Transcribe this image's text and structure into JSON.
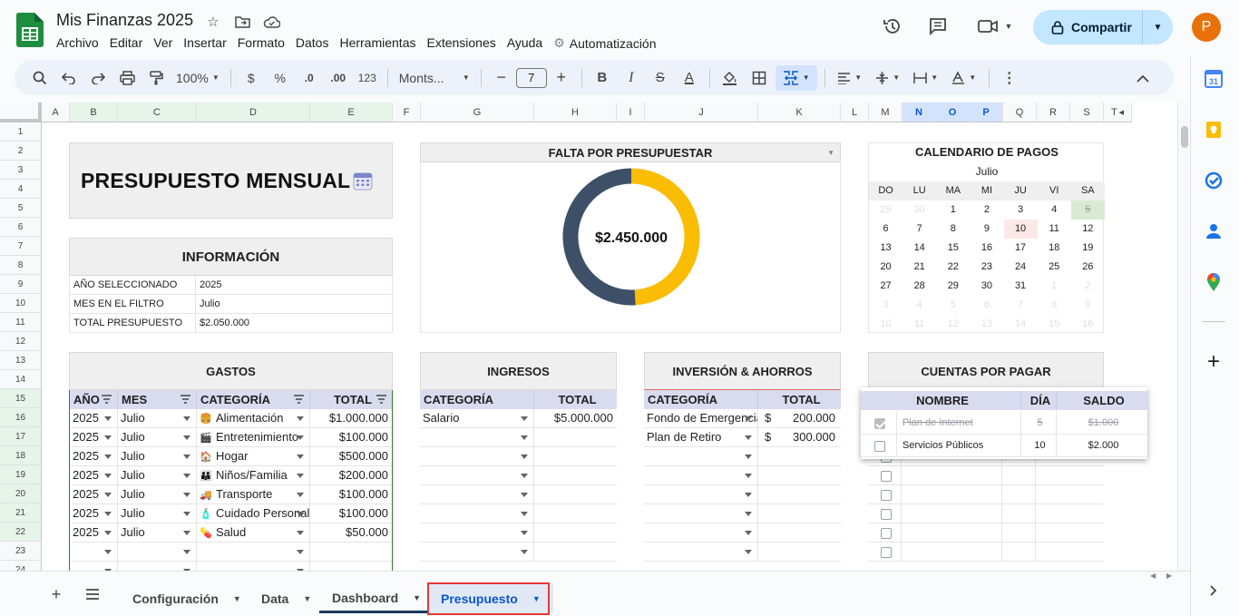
{
  "app": {
    "doc_title": "Mis Finanzas 2025",
    "menu": [
      "Archivo",
      "Editar",
      "Ver",
      "Insertar",
      "Formato",
      "Datos",
      "Herramientas",
      "Extensiones",
      "Ayuda"
    ],
    "automation_label": "Automatización",
    "share_label": "Compartir",
    "avatar_initial": "P"
  },
  "toolbar": {
    "zoom": "100%",
    "currency": "$",
    "percent": "%",
    "dec_decrease": ".0",
    "dec_increase": ".00",
    "number_format": "123",
    "font_name": "Monts...",
    "font_size": "7",
    "bold": "B",
    "italic": "I",
    "strike": "S",
    "text_color": "A"
  },
  "grid": {
    "columns": [
      "A",
      "B",
      "C",
      "D",
      "E",
      "F",
      "G",
      "H",
      "I",
      "J",
      "K",
      "L",
      "M",
      "N",
      "O",
      "P",
      "Q",
      "R",
      "S",
      "T"
    ],
    "rows": [
      "1",
      "2",
      "3",
      "4",
      "5",
      "6",
      "7",
      "8",
      "9",
      "10",
      "11",
      "12",
      "13",
      "14",
      "15",
      "16",
      "17",
      "18",
      "19",
      "20",
      "21",
      "22",
      "23",
      "24"
    ]
  },
  "presupuesto": {
    "title": "PRESUPUESTO MENSUAL",
    "info_header": "INFORMACIÓN",
    "info": [
      {
        "k": "AÑO SELECCIONADO",
        "v": "2025"
      },
      {
        "k": "MES EN EL FILTRO",
        "v": "Julio"
      },
      {
        "k": "TOTAL PRESUPUESTO",
        "v": "$2.050.000"
      }
    ]
  },
  "falta": {
    "header": "FALTA POR PRESUPUESTAR",
    "center_label": "$2.450.000",
    "colors": {
      "filled": "#fbbc04",
      "remaining": "#3d5068"
    }
  },
  "chart_data": {
    "type": "pie",
    "title": "FALTA POR PRESUPUESTAR",
    "center_label": "$2.450.000",
    "slices": [
      {
        "value": 49,
        "color": "#fbbc04"
      },
      {
        "value": 51,
        "color": "#3d5068"
      }
    ]
  },
  "calendario": {
    "header": "CALENDARIO DE PAGOS",
    "month": "Julio",
    "weekdays": [
      "DO",
      "LU",
      "MA",
      "MI",
      "JU",
      "VI",
      "SA"
    ],
    "weeks": [
      [
        {
          "d": "29",
          "s": "dim"
        },
        {
          "d": "30",
          "s": "dim"
        },
        {
          "d": "1"
        },
        {
          "d": "2"
        },
        {
          "d": "3"
        },
        {
          "d": "4"
        },
        {
          "d": "5",
          "s": "done"
        }
      ],
      [
        {
          "d": "6"
        },
        {
          "d": "7"
        },
        {
          "d": "8"
        },
        {
          "d": "9"
        },
        {
          "d": "10",
          "s": "today"
        },
        {
          "d": "11"
        },
        {
          "d": "12"
        }
      ],
      [
        {
          "d": "13"
        },
        {
          "d": "14"
        },
        {
          "d": "15"
        },
        {
          "d": "16"
        },
        {
          "d": "17"
        },
        {
          "d": "18"
        },
        {
          "d": "19"
        }
      ],
      [
        {
          "d": "20"
        },
        {
          "d": "21"
        },
        {
          "d": "22"
        },
        {
          "d": "23"
        },
        {
          "d": "24"
        },
        {
          "d": "25"
        },
        {
          "d": "26"
        }
      ],
      [
        {
          "d": "27"
        },
        {
          "d": "28"
        },
        {
          "d": "29"
        },
        {
          "d": "30"
        },
        {
          "d": "31"
        },
        {
          "d": "1",
          "s": "dim"
        },
        {
          "d": "2",
          "s": "dim"
        }
      ],
      [
        {
          "d": "3",
          "s": "dim"
        },
        {
          "d": "4",
          "s": "dim"
        },
        {
          "d": "5",
          "s": "dim"
        },
        {
          "d": "6",
          "s": "dim"
        },
        {
          "d": "7",
          "s": "dim"
        },
        {
          "d": "8",
          "s": "dim"
        },
        {
          "d": "9",
          "s": "dim"
        }
      ],
      [
        {
          "d": "10",
          "s": "dim"
        },
        {
          "d": "11",
          "s": "dim"
        },
        {
          "d": "12",
          "s": "dim"
        },
        {
          "d": "13",
          "s": "dim"
        },
        {
          "d": "14",
          "s": "dim"
        },
        {
          "d": "15",
          "s": "dim"
        },
        {
          "d": "16",
          "s": "dim"
        }
      ]
    ]
  },
  "gastos": {
    "header": "GASTOS",
    "columns": [
      "AÑO",
      "MES",
      "CATEGORÍA",
      "TOTAL"
    ],
    "rows": [
      {
        "anio": "2025",
        "mes": "Julio",
        "emoji": "🍔",
        "cat": "Alimentación",
        "total": "$1.000.000"
      },
      {
        "anio": "2025",
        "mes": "Julio",
        "emoji": "🎬",
        "cat": "Entretenimiento",
        "total": "$100.000"
      },
      {
        "anio": "2025",
        "mes": "Julio",
        "emoji": "🏠",
        "cat": "Hogar",
        "total": "$500.000"
      },
      {
        "anio": "2025",
        "mes": "Julio",
        "emoji": "👪",
        "cat": "Niños/Familia",
        "total": "$200.000"
      },
      {
        "anio": "2025",
        "mes": "Julio",
        "emoji": "🚚",
        "cat": "Transporte",
        "total": "$100.000"
      },
      {
        "anio": "2025",
        "mes": "Julio",
        "emoji": "🧴",
        "cat": "Cuidado Personal",
        "total": "$100.000"
      },
      {
        "anio": "2025",
        "mes": "Julio",
        "emoji": "💊",
        "cat": "Salud",
        "total": "$50.000"
      }
    ]
  },
  "ingresos": {
    "header": "INGRESOS",
    "columns": [
      "CATEGORÍA",
      "TOTAL"
    ],
    "rows": [
      {
        "cat": "Salario",
        "total": "$5.000.000"
      }
    ]
  },
  "inversion": {
    "header": "INVERSIÓN & AHORROS",
    "columns": [
      "CATEGORÍA",
      "TOTAL"
    ],
    "rows": [
      {
        "cat": "Fondo de Emergencia",
        "cur": "$",
        "total": "200.000"
      },
      {
        "cat": "Plan de Retiro",
        "cur": "$",
        "total": "300.000"
      }
    ]
  },
  "cuentas": {
    "header": "CUENTAS POR PAGAR",
    "columns": [
      "NOMBRE",
      "DÍA",
      "SALDO"
    ],
    "rows": [
      {
        "checked": true,
        "nombre": "Plan de Internet",
        "dia": "5",
        "saldo": "$1.000"
      },
      {
        "checked": false,
        "nombre": "Servicios Públicos",
        "dia": "10",
        "saldo": "$2.000"
      }
    ]
  },
  "sheets": {
    "tabs": [
      "Configuración",
      "Data",
      "Dashboard",
      "Presupuesto"
    ],
    "active": "Presupuesto"
  }
}
